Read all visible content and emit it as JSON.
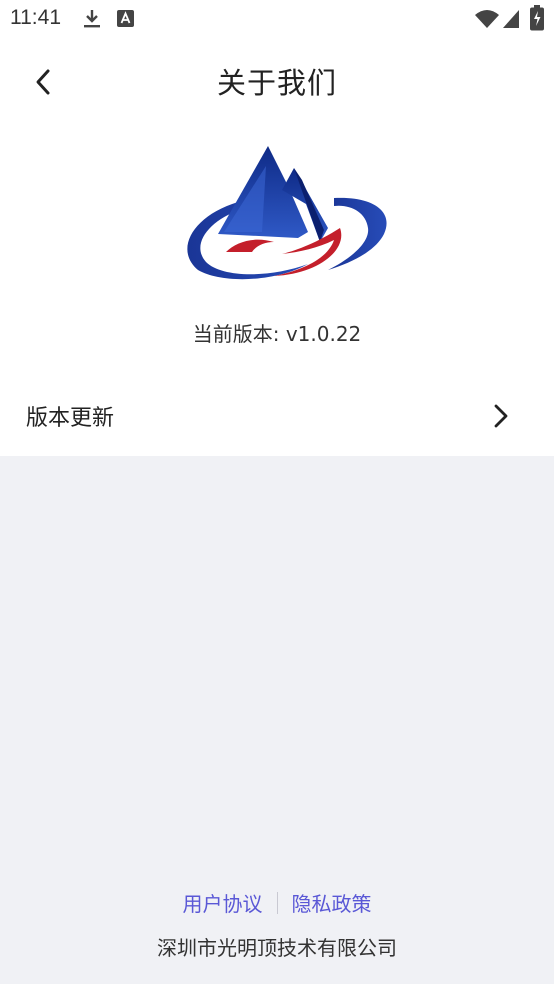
{
  "status_bar": {
    "time": "11:41",
    "icons": [
      "download-icon",
      "a-badge-icon",
      "wifi-icon",
      "signal-icon",
      "battery-icon"
    ]
  },
  "header": {
    "title": "关于我们",
    "back_icon": "chevron-left-icon"
  },
  "about": {
    "version_text": "当前版本: v1.0.22",
    "logo_colors": {
      "blue": "#1f3d9c",
      "red": "#c41f2b"
    }
  },
  "menu": {
    "items": [
      {
        "label": "版本更新",
        "icon": "chevron-right-icon"
      }
    ]
  },
  "footer": {
    "user_agreement": "用户协议",
    "privacy_policy": "隐私政策",
    "company": "深圳市光明顶技术有限公司",
    "link_color": "#5a58d6"
  }
}
